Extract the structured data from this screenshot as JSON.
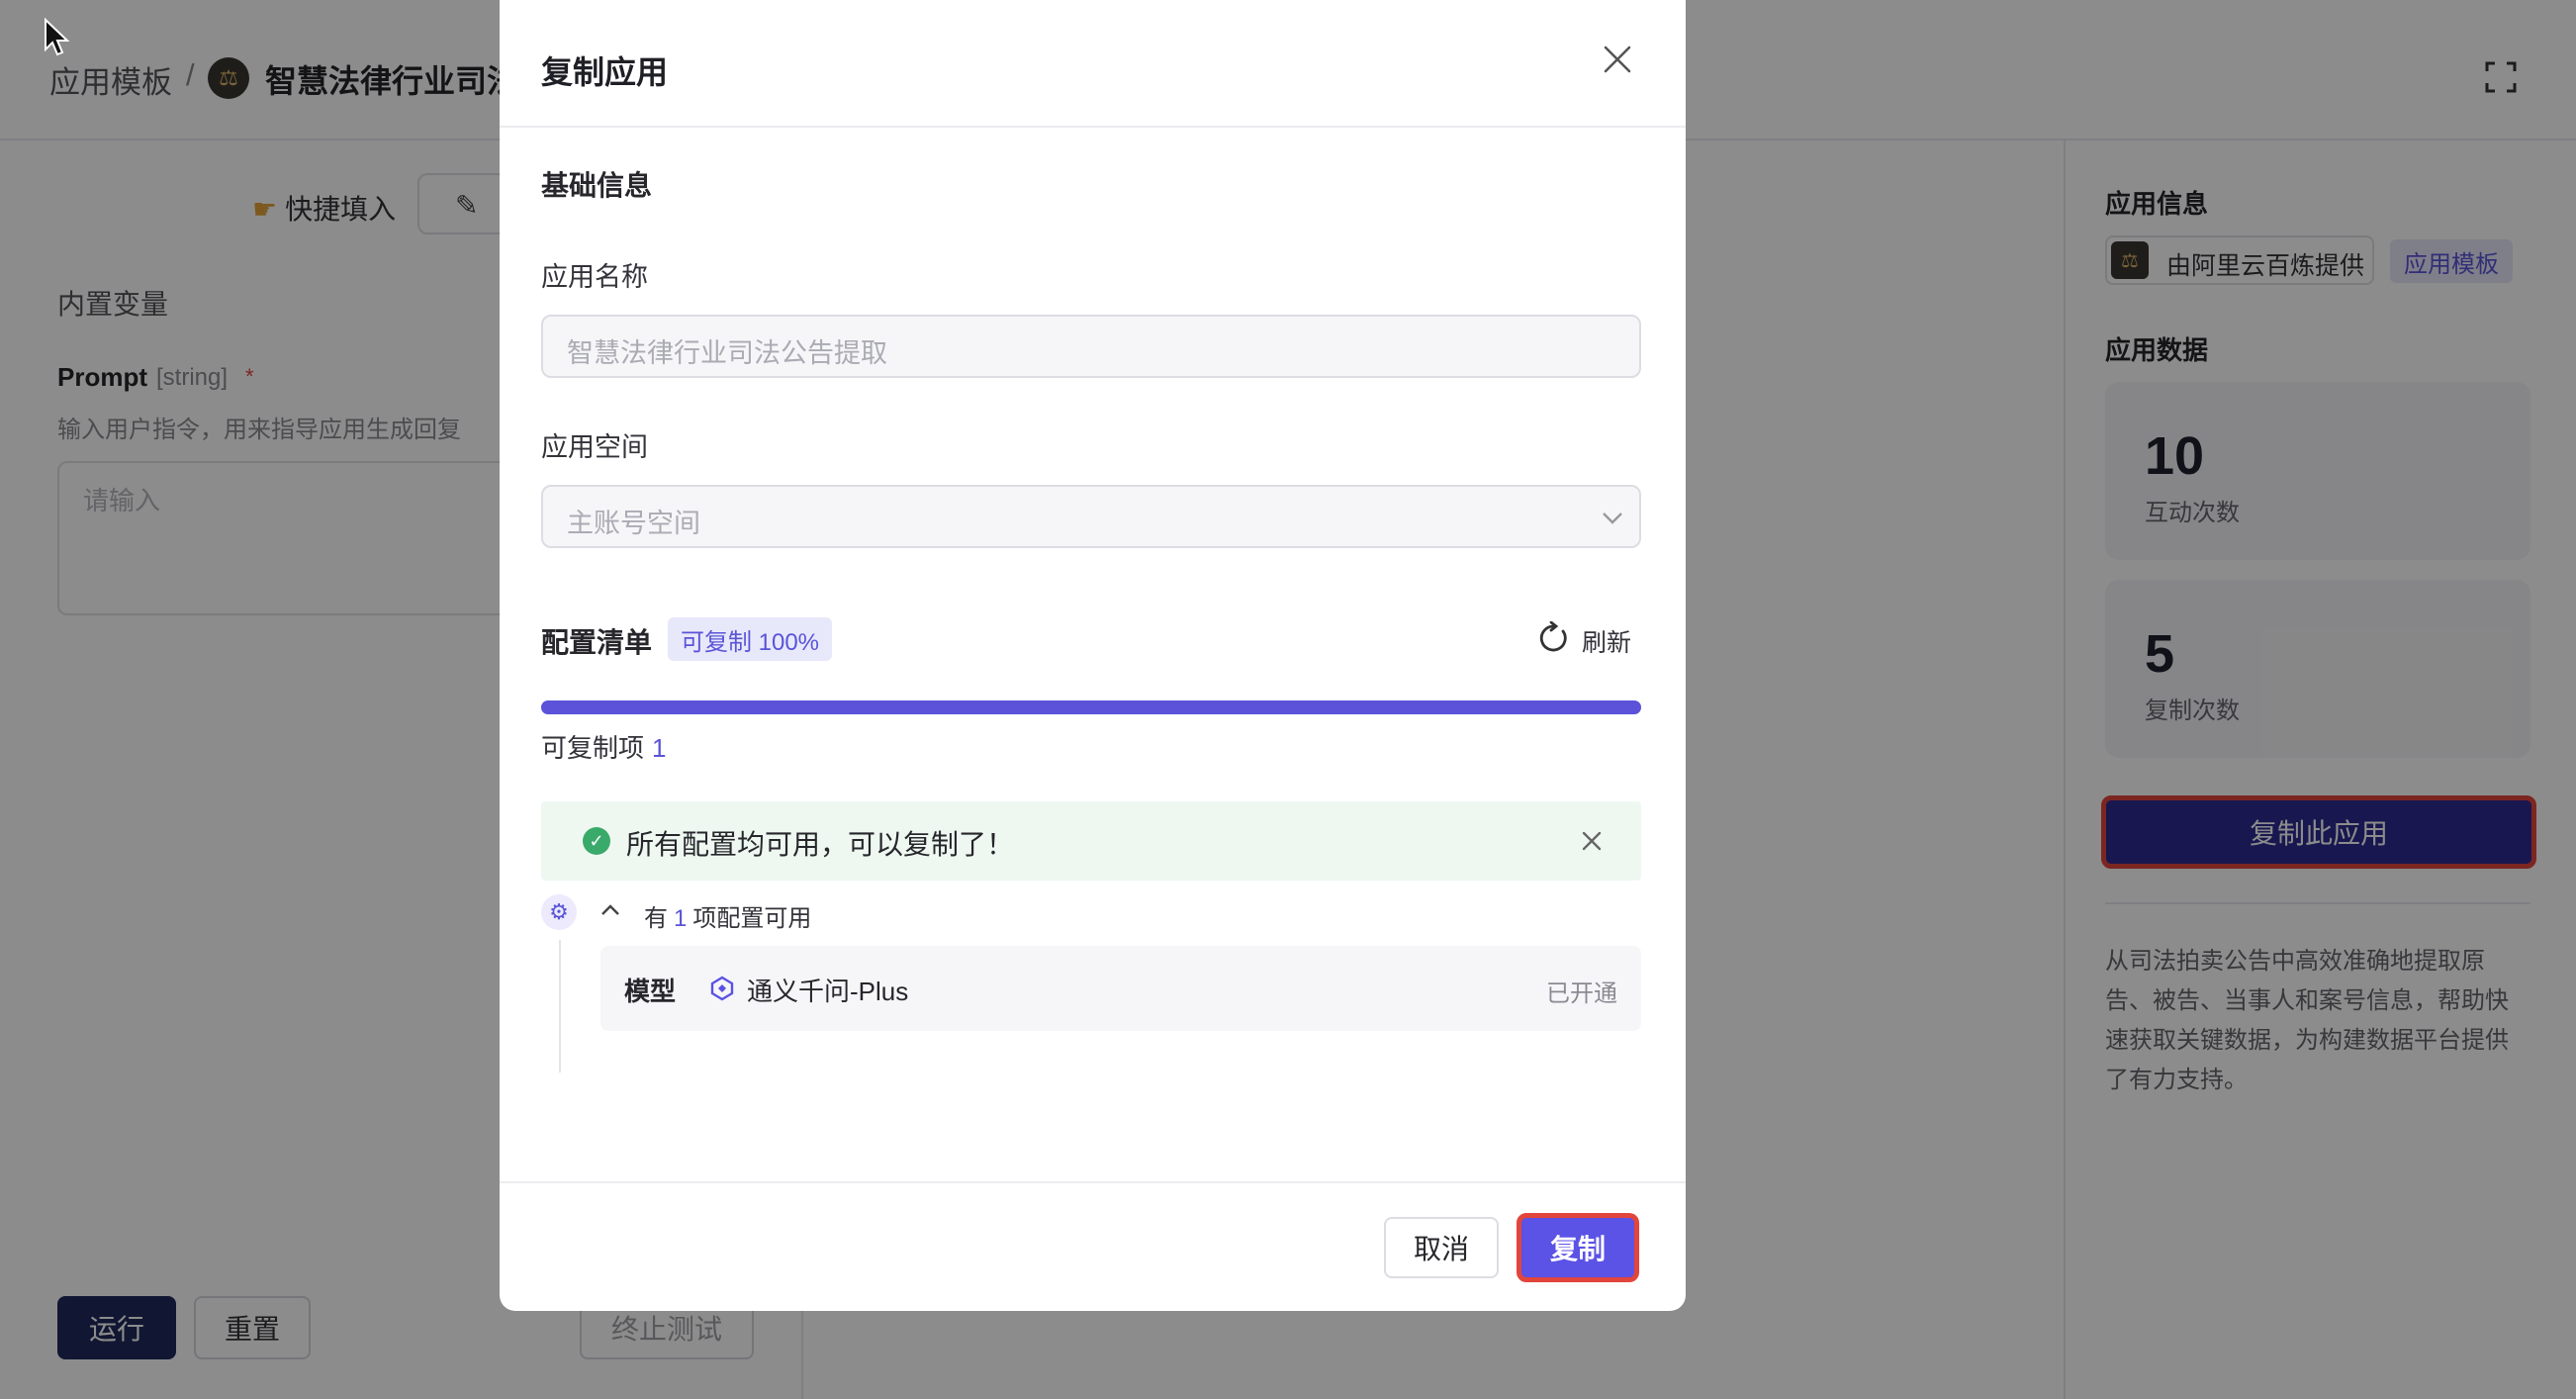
{
  "breadcrumb": {
    "root": "应用模板",
    "separator": "/",
    "app_name": "智慧法律行业司法"
  },
  "left_panel": {
    "quick_fill": "快捷填入",
    "builtin_vars": "内置变量",
    "prompt_label": "Prompt",
    "prompt_type": "[string]",
    "prompt_required": "*",
    "prompt_hint": "输入用户指令，用来指导应用生成回复",
    "prompt_placeholder": "请输入",
    "run": "运行",
    "reset": "重置",
    "stop": "终止测试"
  },
  "right_panel": {
    "info_title": "应用信息",
    "provider": "由阿里云百炼提供",
    "template_badge": "应用模板",
    "data_title": "应用数据",
    "stats": [
      {
        "value": "10",
        "label": "互动次数"
      },
      {
        "value": "5",
        "label": "复制次数"
      }
    ],
    "copy_app_button": "复制此应用",
    "description": "从司法拍卖公告中高效准确地提取原告、被告、当事人和案号信息，帮助快速获取关键数据，为构建数据平台提供了有力支持。"
  },
  "modal": {
    "title": "复制应用",
    "section_basic": "基础信息",
    "app_name_label": "应用名称",
    "app_name_placeholder": "智慧法律行业司法公告提取",
    "space_label": "应用空间",
    "space_placeholder": "主账号空间",
    "config_title": "配置清单",
    "config_badge": "可复制 100%",
    "refresh": "刷新",
    "progress_fraction": 1.0,
    "copyable_label": "可复制项",
    "copyable_count": "1",
    "alert_text": "所有配置均可用，可以复制了！",
    "available_prefix": "有",
    "available_count": "1",
    "available_suffix": "项配置可用",
    "model_label": "模型",
    "model_name": "通义千问-Plus",
    "model_status": "已开通",
    "cancel": "取消",
    "confirm": "复制"
  },
  "colors": {
    "accent": "#5b52e6",
    "dark_button": "#2d2a93",
    "highlight_border": "#e2453c",
    "success": "#3aaa6a"
  }
}
